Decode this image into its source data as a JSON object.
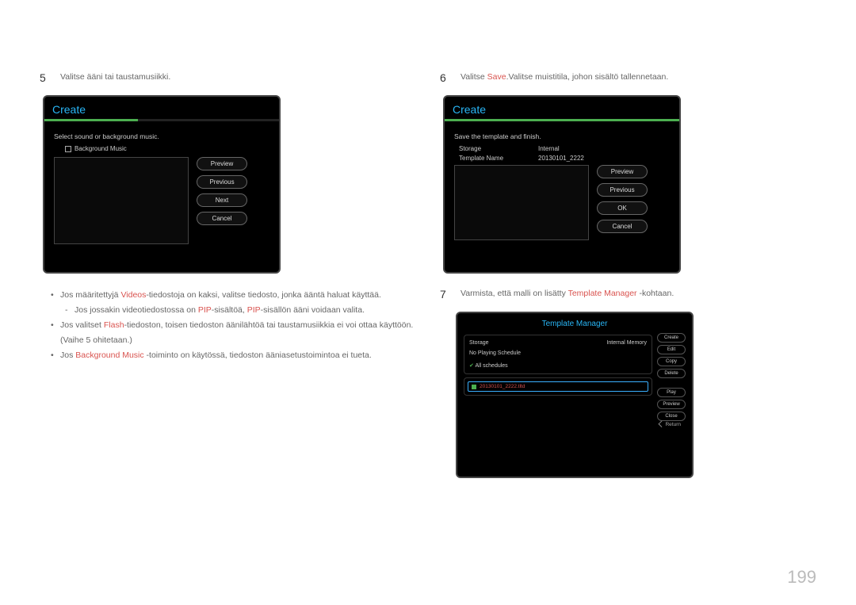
{
  "page_number": "199",
  "left": {
    "step5_num": "5",
    "step5_text": "Valitse ääni tai taustamusiikki.",
    "panel": {
      "title": "Create",
      "instr": "Select sound or background music.",
      "bg_music": "Background Music",
      "buttons": {
        "preview": "Preview",
        "previous": "Previous",
        "next": "Next",
        "cancel": "Cancel"
      }
    },
    "bul1_a": "Jos määritettyjä ",
    "bul1_b": "Videos",
    "bul1_c": "-tiedostoja on kaksi, valitse tiedosto, jonka ääntä haluat käyttää.",
    "bul1s_a": "Jos jossakin videotiedostossa on ",
    "bul1s_b": "PIP",
    "bul1s_c": "-sisältöä, ",
    "bul1s_d": "PIP",
    "bul1s_e": "-sisällön ääni voidaan valita.",
    "bul2_a": "Jos valitset ",
    "bul2_b": "Flash",
    "bul2_c": "-tiedoston, toisen tiedoston äänilähtöä tai taustamusiikkia ei voi ottaa käyttöön. (Vaihe 5 ohitetaan.)",
    "bul3_a": "Jos ",
    "bul3_b": "Background Music",
    "bul3_c": " -toiminto on käytössä, tiedoston ääniasetustoimintoa ei tueta."
  },
  "right": {
    "step6_num": "6",
    "step6_a": "Valitse ",
    "step6_b": "Save",
    "step6_c": ".Valitse muistitila, johon sisältö tallennetaan.",
    "panel6": {
      "title": "Create",
      "instr": "Save the template and ﬁnish.",
      "storage_k": "Storage",
      "storage_v": "Internal",
      "tname_k": "Template Name",
      "tname_v": "20130101_2222",
      "buttons": {
        "preview": "Preview",
        "previous": "Previous",
        "ok": "OK",
        "cancel": "Cancel"
      }
    },
    "step7_num": "7",
    "step7_a": "Varmista, että malli on lisätty ",
    "step7_b": "Template Manager",
    "step7_c": " -kohtaan.",
    "tm": {
      "title": "Template Manager",
      "storage_k": "Storage",
      "storage_v": "Internal Memory",
      "no_sched": "No Playing Schedule",
      "all_sched": "All schedules",
      "file": "20130101_2222.tltd",
      "buttons": {
        "create": "Create",
        "edit": "Edit",
        "copy": "Copy",
        "delete": "Delete",
        "play": "Play",
        "preview": "Preview",
        "close": "Close"
      },
      "return": "Return"
    }
  }
}
